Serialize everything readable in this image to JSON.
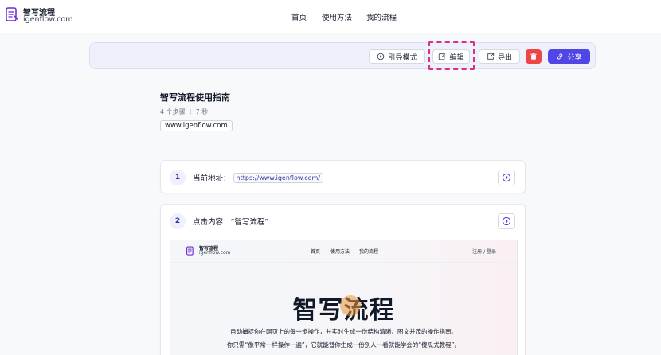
{
  "header": {
    "brand_name": "智写流程",
    "brand_domain": "igenflow.com",
    "nav": {
      "home": "首页",
      "usage": "使用方法",
      "mine": "我的流程"
    }
  },
  "toolbar": {
    "guide_label": "引导模式",
    "edit_label": "编辑",
    "export_label": "导出",
    "share_label": "分享"
  },
  "flow": {
    "title": "智写流程使用指南",
    "steps_count": "4 个步骤",
    "duration": "7 秒",
    "url_tag": "www.igenflow.com"
  },
  "steps": [
    {
      "number": "1",
      "label": "当前地址：",
      "url": "https://www.igenflow.com/"
    },
    {
      "number": "2",
      "label": "点击内容：“智写流程”"
    }
  ],
  "screenshot": {
    "brand_name": "智写流程",
    "brand_domain": "igenflow.com",
    "nav": {
      "home": "首页",
      "usage": "使用方法",
      "mine": "我的流程"
    },
    "login": "注册 / 登录",
    "hero": "智写流程",
    "desc_line1": "自动捕捉你在网页上的每一步操作，并实时生成一份结构清晰、图文并茂的操作指南。",
    "desc_line2": "你只需“像平常一样操作一遍”，它就能替你生成一份别人一看就能学会的“傻瓜式教程”。"
  },
  "colors": {
    "accent": "#4f46e5",
    "danger": "#ef4444",
    "highlight": "#d63384",
    "toolbar_bg": "#eef1fb"
  },
  "icons": {
    "logo": "document-logo-icon",
    "guide": "guide-play-icon",
    "edit": "edit-icon",
    "export": "export-icon",
    "delete": "trash-icon",
    "share": "link-icon"
  }
}
